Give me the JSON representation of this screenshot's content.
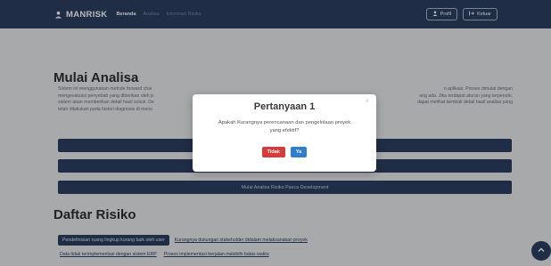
{
  "nav": {
    "brand": "MANRISK",
    "links": [
      "Beranda",
      "Analisa",
      "Informasi Risiko"
    ],
    "profile_label": "Profil",
    "logout_label": "Keluar"
  },
  "main": {
    "title": "Mulai Analisa",
    "description": "Sistem ini menggunakan metode forward chai... ...n aplikasi. Proses dimulai dengan mengevaluasi penyebab yang diberikan oleh p... ...ang ada. Jika terdapat aturan yang terpenuhi, sistem akan memberikan detail hasil solusi. De... ...dapat melihat kembali detail hasil analisa yang telah dilakukan pada histori diagnosis di menu",
    "description_lines": [
      "Sistem ini menggunakan metode forward chai",
      "mengevaluasi penyebab yang diberikan oleh p",
      "sistem akan memberikan detail hasil solusi. De",
      "telah dilakukan pada histori diagnosis di menu"
    ],
    "description_right_lines": [
      "n aplikasi. Proses dimulai dengan",
      "ang ada. Jika terdapat aturan yang terpenuhi,",
      "dapat melihat kembali detail hasil analisa yang",
      ""
    ],
    "buttons": [
      "",
      "",
      "Mulai Analisa Risiko Pasca Development"
    ]
  },
  "risks": {
    "title": "Daftar Risiko",
    "row1": [
      "Pendefinisian ruang lingkup kurang baik oleh user",
      "Kurangnya dukungan stakeholder didalam melaksanakan proyek"
    ],
    "row2": [
      "Data tidak terimplementasi dengan sistem ERP",
      "Proses implementasi berjalan melebihi batas waktu"
    ]
  },
  "modal": {
    "title": "Pertanyaan 1",
    "question": "Apakah Kurangnya perencanaan dan pengelolaan proyek yang efektif?",
    "no_label": "Tidak",
    "yes_label": "Ya",
    "close_symbol": "×"
  },
  "colors": {
    "navy": "#2b3f63",
    "danger": "#d93a3a",
    "primary": "#2f7fd0"
  }
}
